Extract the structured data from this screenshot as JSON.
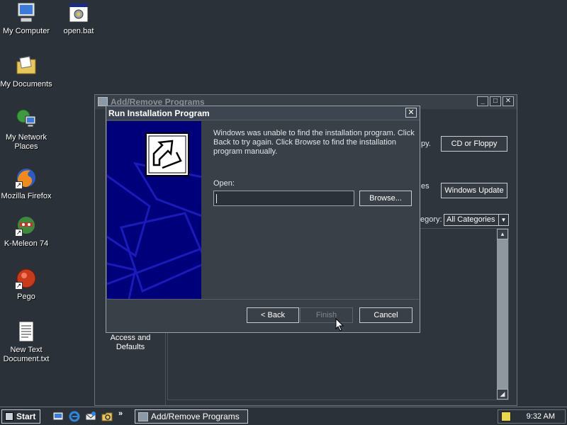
{
  "desktop": {
    "icons": [
      {
        "label": "My Computer",
        "icon": "computer-icon"
      },
      {
        "label": "open.bat",
        "icon": "batch-file-icon"
      },
      {
        "label": "My Documents",
        "icon": "folder-documents-icon"
      },
      {
        "label": "My Network Places",
        "icon": "network-icon"
      },
      {
        "label": "Mozilla Firefox",
        "icon": "firefox-icon"
      },
      {
        "label": "K-Meleon 74",
        "icon": "kmeleon-icon"
      },
      {
        "label": "Pego",
        "icon": "pego-icon"
      },
      {
        "label": "New Text Document.txt",
        "icon": "text-file-icon"
      }
    ]
  },
  "add_remove": {
    "title": "Add/Remove Programs",
    "left_selected_label": "Access and Defaults",
    "right_text_py": "py.",
    "right_text_es": "es",
    "cd_button": "CD or Floppy",
    "update_button": "Windows Update",
    "category_label": "egory:",
    "category_value": "All Categories"
  },
  "dialog": {
    "title": "Run Installation Program",
    "message": "Windows was unable to find the installation program.  Click Back to try again.  Click Browse to find the installation program manually.",
    "open_label": "Open:",
    "open_value": "",
    "browse_button": "Browse...",
    "back_button": "< Back",
    "finish_button": "Finish",
    "cancel_button": "Cancel"
  },
  "taskbar": {
    "start_label": "Start",
    "chevron": "»",
    "task_label": "Add/Remove Programs",
    "clock": "9:32 AM"
  },
  "colors": {
    "desktop_bg": "#2b3138",
    "wizard_art_bg": "#00007a"
  }
}
